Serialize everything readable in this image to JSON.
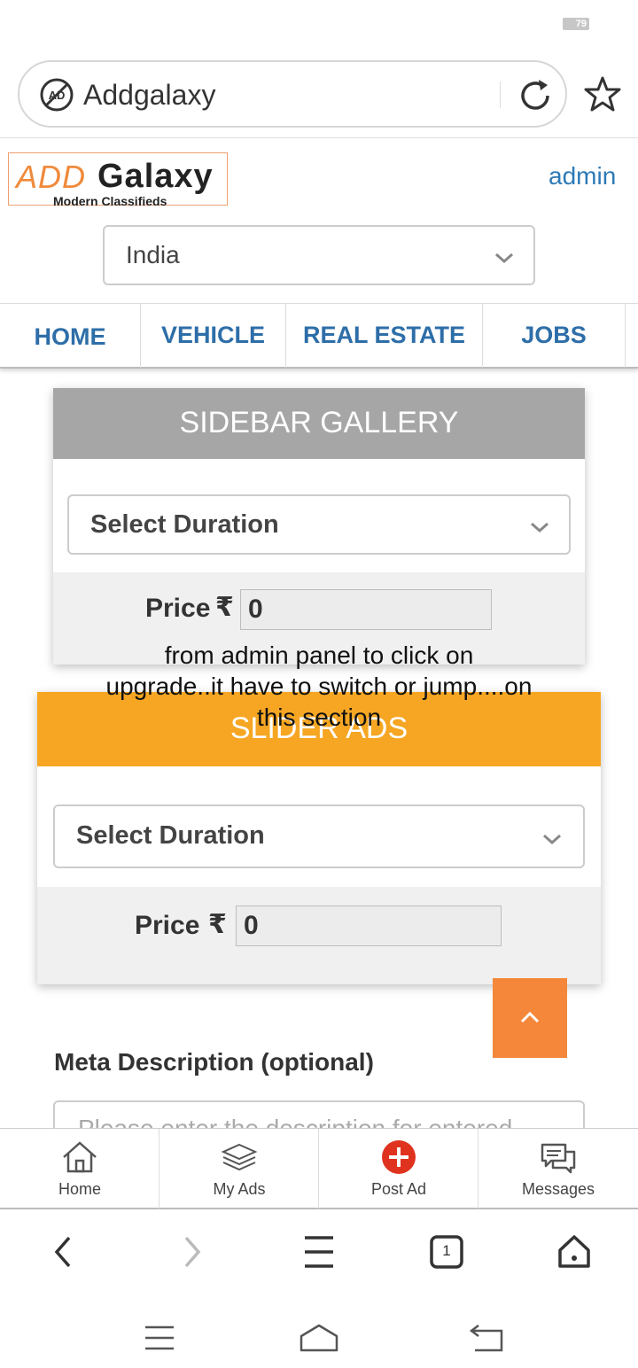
{
  "status_bar": {
    "battery": "79"
  },
  "browser": {
    "url_text": "Addgalaxy",
    "site_icon_label": "AD"
  },
  "header": {
    "logo_add": "ADD",
    "logo_galaxy": "Galaxy",
    "logo_tagline": "Modern Classifieds",
    "admin_link": "admin",
    "country_selected": "India"
  },
  "nav": {
    "items": [
      {
        "label": "HOME"
      },
      {
        "label": "VEHICLE"
      },
      {
        "label": "REAL ESTATE"
      },
      {
        "label": "JOBS"
      }
    ]
  },
  "sidebar_gallery": {
    "title": "SIDEBAR GALLERY",
    "duration_placeholder": "Select Duration",
    "price_label": "Price",
    "currency": "₹",
    "price_value": "0",
    "header_color": "#a6a6a6"
  },
  "overlay_note": {
    "line1": "from admin panel to click on",
    "line2": "upgrade..it have to switch or jump....on",
    "line3": "this section"
  },
  "slider_ads": {
    "title": "SLIDER ADS",
    "duration_placeholder": "Select Duration",
    "price_label": "Price",
    "currency": "₹",
    "price_value": "0",
    "header_color": "#f6a623"
  },
  "meta": {
    "label": "Meta Description (optional)",
    "placeholder": "Please enter the description for entered"
  },
  "app_nav": {
    "items": [
      {
        "label": "Home",
        "icon": "home-icon"
      },
      {
        "label": "My Ads",
        "icon": "layers-icon"
      },
      {
        "label": "Post Ad",
        "icon": "plus-circle-icon"
      },
      {
        "label": "Messages",
        "icon": "chat-icon"
      }
    ]
  },
  "browser_toolbar": {
    "tab_count": "1"
  },
  "colors": {
    "accent": "#f4873a",
    "link": "#2d6ea8",
    "post_ad": "#e0331f"
  }
}
